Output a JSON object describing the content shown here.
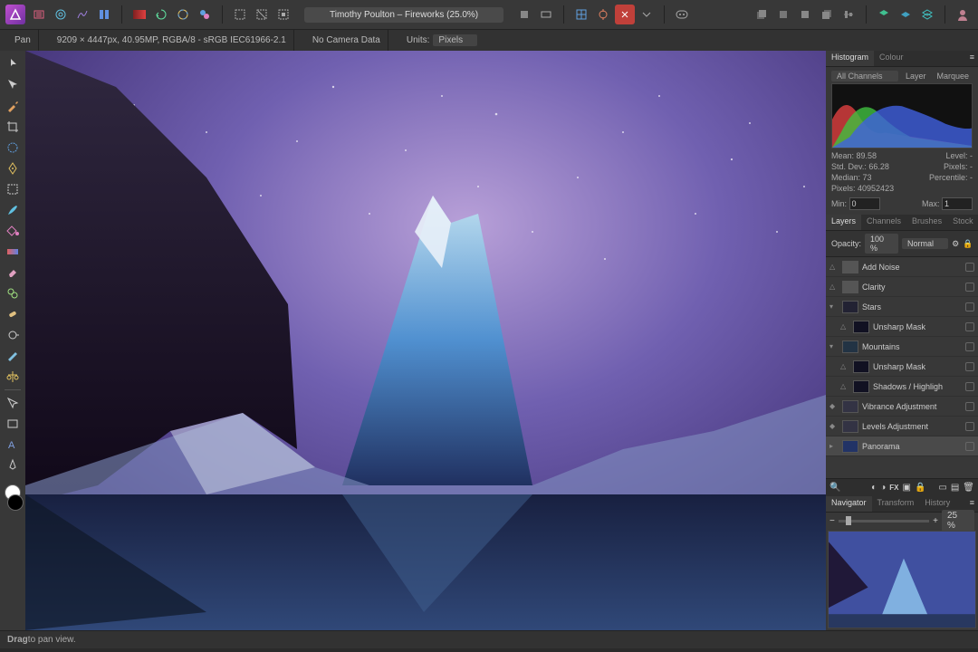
{
  "header": {
    "doc_title": "Timothy Poulton – Fireworks (25.0%)"
  },
  "contextbar": {
    "tool": "Pan",
    "dimensions": "9209 × 4447px, 40.95MP, RGBA/8 - sRGB IEC61966-2.1",
    "camera": "No Camera Data",
    "units_label": "Units:",
    "units_value": "Pixels"
  },
  "histogram": {
    "tab_hist": "Histogram",
    "tab_colour": "Colour",
    "channels": "All Channels",
    "mode_layer": "Layer",
    "mode_marquee": "Marquee",
    "stats": {
      "mean_l": "Mean:",
      "mean_v": "89.58",
      "std_l": "Std. Dev.:",
      "std_v": "66.28",
      "median_l": "Median:",
      "median_v": "73",
      "pixels_l": "Pixels:",
      "pixels_v": "40952423",
      "level_l": "Level:",
      "level_v": "-",
      "pix2_l": "Pixels:",
      "pix2_v": "-",
      "perc_l": "Percentile:",
      "perc_v": "-"
    },
    "min_l": "Min:",
    "min_v": "0",
    "max_l": "Max:",
    "max_v": "1"
  },
  "layers_panel": {
    "tab_layers": "Layers",
    "tab_channels": "Channels",
    "tab_brushes": "Brushes",
    "tab_stock": "Stock",
    "opacity_l": "Opacity:",
    "opacity_v": "100 %",
    "blend": "Normal",
    "items": [
      {
        "name": "Add Noise",
        "type": "fx",
        "thumb": "#555"
      },
      {
        "name": "Clarity",
        "type": "fx",
        "thumb": "#555"
      },
      {
        "name": "Stars",
        "type": "group",
        "thumb": "#223"
      },
      {
        "name": "Unsharp Mask",
        "type": "fx",
        "thumb": "#112",
        "indent": 1
      },
      {
        "name": "Mountains",
        "type": "group",
        "thumb": "#234"
      },
      {
        "name": "Unsharp Mask",
        "type": "fx",
        "thumb": "#112",
        "indent": 1
      },
      {
        "name": "Shadows / Highligh",
        "type": "fx",
        "thumb": "#112",
        "indent": 1
      },
      {
        "name": "Vibrance Adjustment",
        "type": "adj",
        "thumb": "#334"
      },
      {
        "name": "Levels Adjustment",
        "type": "adj",
        "thumb": "#334"
      },
      {
        "name": "Panorama",
        "type": "img",
        "thumb": "#236",
        "sel": true
      }
    ]
  },
  "navigator": {
    "tab_nav": "Navigator",
    "tab_xform": "Transform",
    "tab_history": "History",
    "zoom": "25 %"
  },
  "statusbar": {
    "hint_a": "Drag",
    "hint_b": " to pan view."
  }
}
